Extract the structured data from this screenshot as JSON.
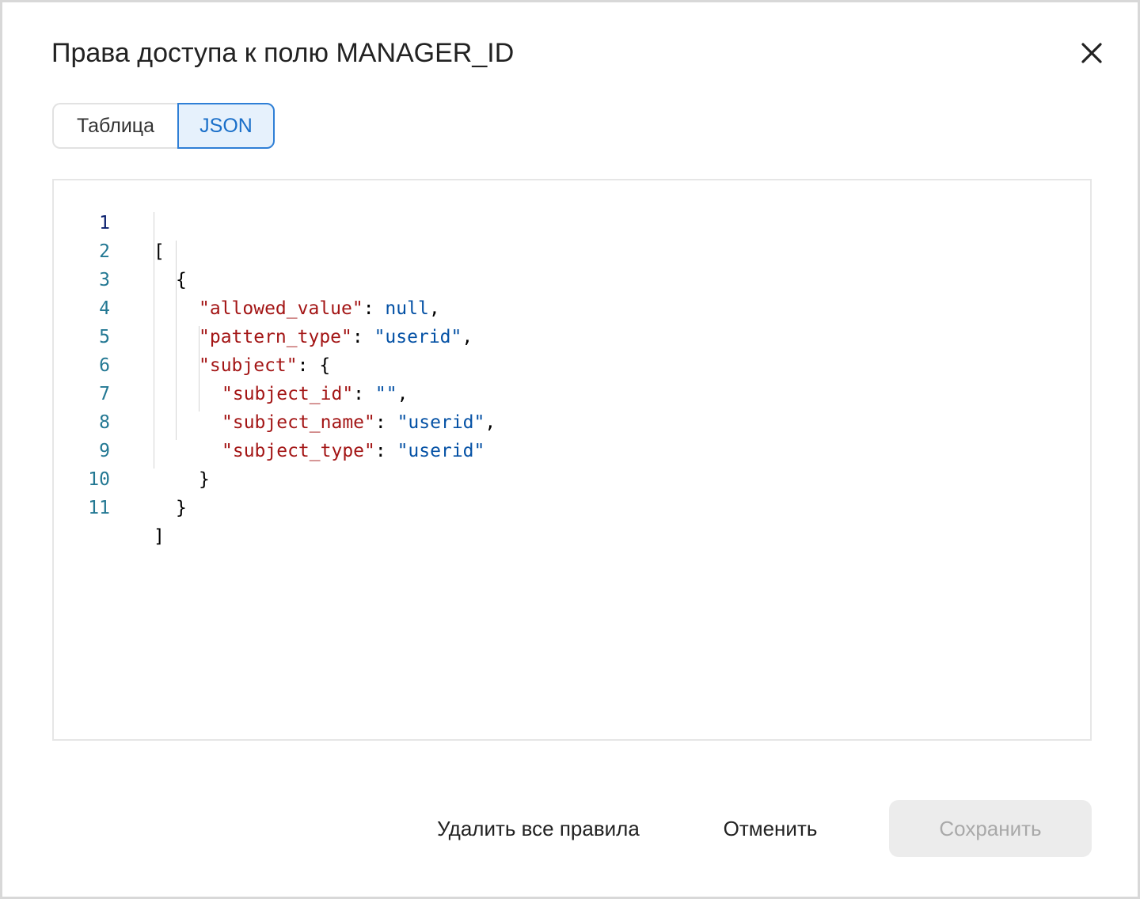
{
  "dialog": {
    "title": "Права доступа к полю MANAGER_ID",
    "close_icon": "close-icon"
  },
  "view_tabs": [
    {
      "label": "Таблица",
      "selected": false
    },
    {
      "label": "JSON",
      "selected": true
    }
  ],
  "editor": {
    "line_numbers": [
      "1",
      "2",
      "3",
      "4",
      "5",
      "6",
      "7",
      "8",
      "9",
      "10",
      "11"
    ],
    "colors": {
      "key": "#a31515",
      "string_value": "#0451a5",
      "line_number": "#237893",
      "active_line_number": "#0b216f"
    },
    "lines": {
      "l1": {
        "text": "["
      },
      "l2": {
        "text": "{"
      },
      "l3": {
        "key": "\"allowed_value\"",
        "sep": ": ",
        "value": "null",
        "end": ","
      },
      "l4": {
        "key": "\"pattern_type\"",
        "sep": ": ",
        "value": "\"userid\"",
        "end": ","
      },
      "l5": {
        "key": "\"subject\"",
        "sep": ": ",
        "end": "{"
      },
      "l6": {
        "key": "\"subject_id\"",
        "sep": ": ",
        "value": "\"\"",
        "end": ","
      },
      "l7": {
        "key": "\"subject_name\"",
        "sep": ": ",
        "value": "\"userid\"",
        "end": ","
      },
      "l8": {
        "key": "\"subject_type\"",
        "sep": ": ",
        "value": "\"userid\"",
        "end": ""
      },
      "l9": {
        "text": "}"
      },
      "l10": {
        "text": "}"
      },
      "l11": {
        "text": "]"
      }
    }
  },
  "footer": {
    "delete_label": "Удалить все правила",
    "cancel_label": "Отменить",
    "save_label": "Сохранить",
    "save_enabled": false
  }
}
